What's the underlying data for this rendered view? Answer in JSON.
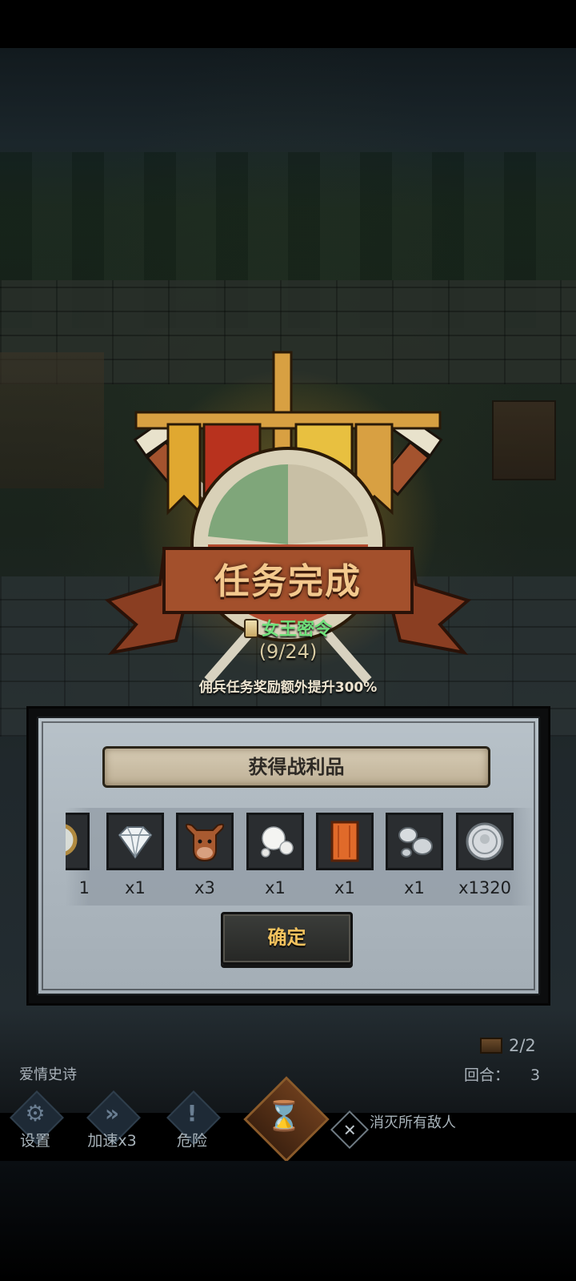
{
  "quest_complete": {
    "title": "任务完成",
    "item_name": "女王密令",
    "progress": "(9/24)",
    "bonus_text": "佣兵任务奖励额外提升300%"
  },
  "loot": {
    "title": "获得战利品",
    "items": [
      {
        "icon": "mirror-icon",
        "count": "1"
      },
      {
        "icon": "diamond-icon",
        "count": "x1"
      },
      {
        "icon": "cow-head-icon",
        "count": "x3"
      },
      {
        "icon": "pearls-icon",
        "count": "x1"
      },
      {
        "icon": "orange-plank-icon",
        "count": "x1"
      },
      {
        "icon": "silver-ore-icon",
        "count": "x1"
      },
      {
        "icon": "silver-coin-icon",
        "count": "x1320"
      }
    ],
    "confirm_label": "确定"
  },
  "hud": {
    "stage_name": "爱情史诗",
    "round_label": "回合：",
    "round_value": "3",
    "chest_count": "2/2",
    "buttons": [
      {
        "icon": "gear-icon",
        "label": "设置"
      },
      {
        "icon": "fast-forward-icon",
        "label": "加速x3"
      },
      {
        "icon": "warning-icon",
        "label": "危险"
      }
    ],
    "objective": "消灭所有敌人"
  },
  "colors": {
    "title_gold": "#f3c98e",
    "quest_green": "#6fe07a",
    "confirm_gold": "#f2c25e",
    "panel_bg": "#aeb8c0"
  }
}
